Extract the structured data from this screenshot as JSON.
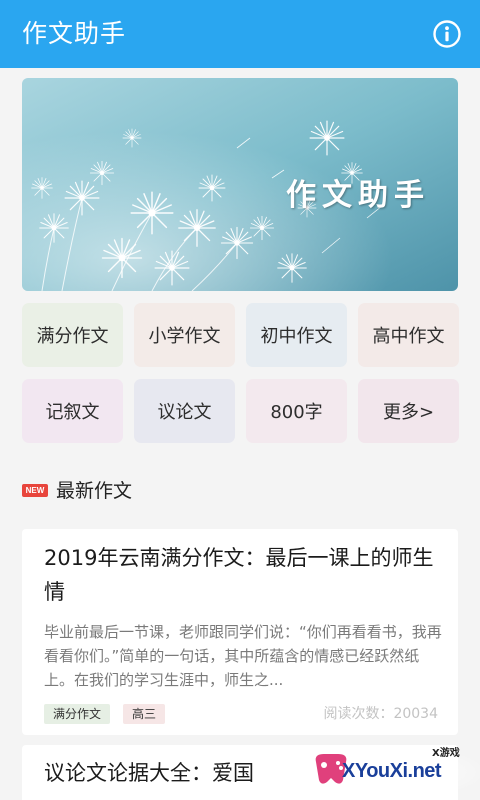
{
  "app": {
    "title": "作文助手",
    "accent_color": "#2aa6f0",
    "info_icon": "info-icon"
  },
  "banner": {
    "text": "作文助手",
    "image": "dandelion-banner"
  },
  "categories": [
    {
      "label": "满分作文",
      "color": "#eaf0e6"
    },
    {
      "label": "小学作文",
      "color": "#f3ebe8"
    },
    {
      "label": "初中作文",
      "color": "#e6ecf1"
    },
    {
      "label": "高中作文",
      "color": "#f3eae8"
    },
    {
      "label": "记叙文",
      "color": "#f2e7f1"
    },
    {
      "label": "议论文",
      "color": "#e7e8f0"
    },
    {
      "label": "800字",
      "color": "#f3e9ee"
    },
    {
      "label": "更多>",
      "color": "#f2e6ec"
    }
  ],
  "latest": {
    "badge": "NEW",
    "title": "最新作文",
    "articles": [
      {
        "title": "2019年云南满分作文：最后一课上的师生情",
        "summary": "毕业前最后一节课，老师跟同学们说：“你们再看看书，我再看看你们。”简单的一句话，其中所蕴含的情感已经跃然纸上。在我们的学习生涯中，师生之...",
        "tags": [
          "满分作文",
          "高三"
        ],
        "read_label": "阅读次数：",
        "read_count": "20034"
      },
      {
        "title": "议论文论据大全：爱国"
      }
    ]
  },
  "watermark": {
    "small": "X游戏",
    "big": "XYouXi.net"
  }
}
